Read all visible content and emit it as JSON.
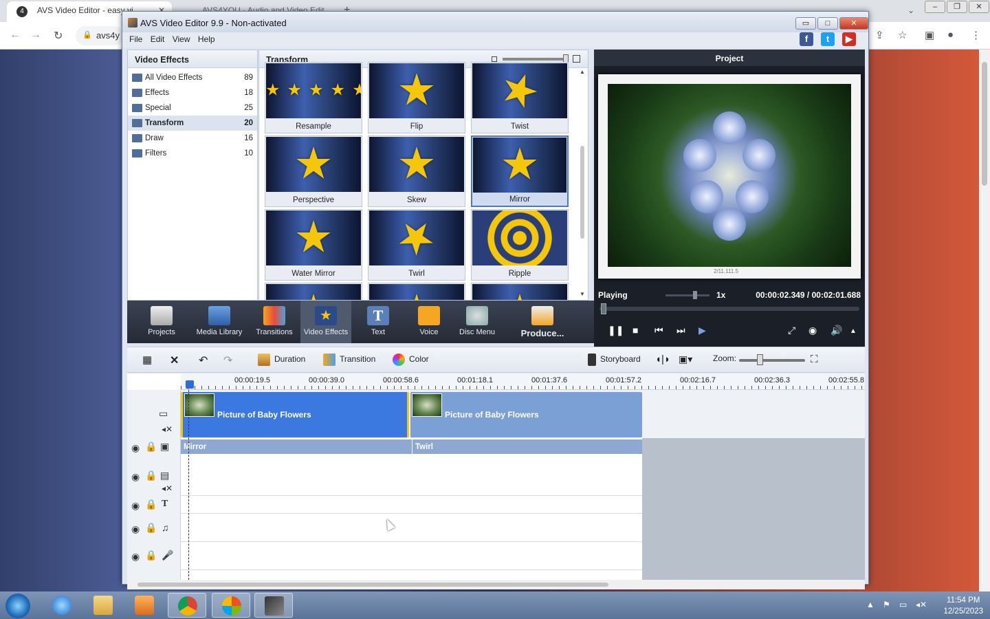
{
  "browser": {
    "active_tab": "AVS Video Editor - easy vi",
    "inactive_tab": "AVS4YOU - Audio and Video Edit",
    "url": "avs4y"
  },
  "app": {
    "title": "AVS Video Editor 9.9 - Non-activated",
    "menu": [
      "File",
      "Edit",
      "View",
      "Help"
    ],
    "social": [
      "f",
      "t",
      "▶"
    ]
  },
  "effects_panel": {
    "header": "Video Effects",
    "items": [
      {
        "label": "All Video Effects",
        "count": "89"
      },
      {
        "label": "Effects",
        "count": "18"
      },
      {
        "label": "Special",
        "count": "25"
      },
      {
        "label": "Transform",
        "count": "20"
      },
      {
        "label": "Draw",
        "count": "16"
      },
      {
        "label": "Filters",
        "count": "10"
      }
    ]
  },
  "transform_panel": {
    "header": "Transform",
    "tiles": [
      "Resample",
      "Flip",
      "Twist",
      "Perspective",
      "Skew",
      "Mirror",
      "Water Mirror",
      "Twirl",
      "Ripple"
    ]
  },
  "project": {
    "header": "Project",
    "status": "Playing",
    "speed": "1x",
    "time": "00:00:02.349  /  00:02:01.688",
    "signature": "2/11.111.5"
  },
  "toolbar": {
    "items": [
      "Projects",
      "Media Library",
      "Transitions",
      "Video Effects",
      "Text",
      "Voice",
      "Disc Menu",
      "Produce..."
    ]
  },
  "timeline_toolbar": {
    "duration": "Duration",
    "transition": "Transition",
    "color": "Color",
    "storyboard": "Storyboard",
    "zoom": "Zoom:"
  },
  "timeline": {
    "ticks": [
      "00:00:19.5",
      "00:00:39.0",
      "00:00:58.6",
      "00:01:18.1",
      "00:01:37.6",
      "00:01:57.2",
      "00:02:16.7",
      "00:02:36.3",
      "00:02:55.8"
    ],
    "clips": [
      "Picture of Baby Flowers",
      "Picture of Baby Flowers"
    ],
    "effects": [
      "Mirror",
      "Twirl"
    ]
  },
  "taskbar": {
    "time": "11:54 PM",
    "date": "12/25/2023"
  },
  "colors": {
    "accent": "#3b78e0",
    "clip_selected": "#3b78e0",
    "clip_other": "#7ba0d6",
    "star": "#f4c60c"
  }
}
